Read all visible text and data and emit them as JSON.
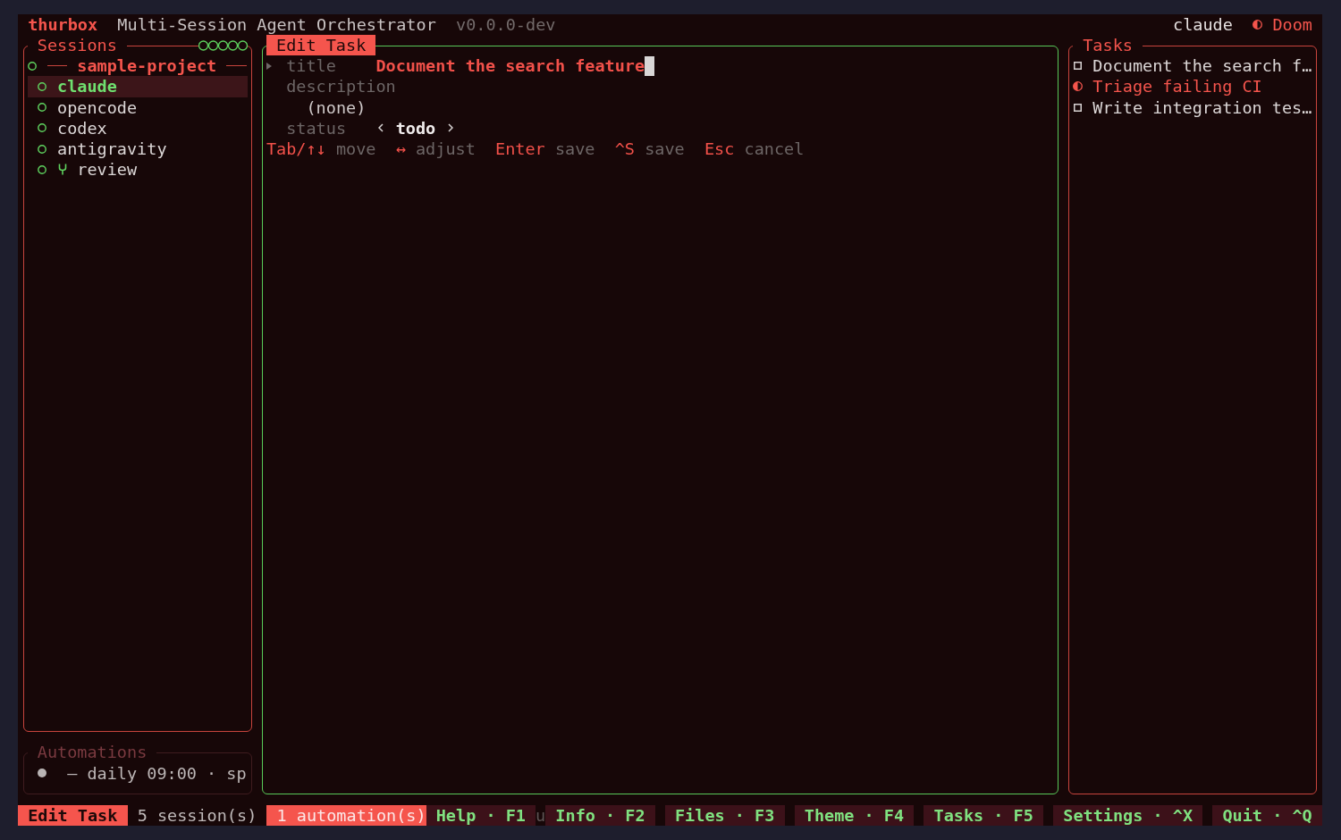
{
  "header": {
    "app_name": "thurbox",
    "title": "Multi-Session Agent Orchestrator",
    "version": "v0.0.0-dev",
    "session": "claude",
    "theme": "Doom"
  },
  "sessions_panel": {
    "title": "Sessions",
    "focused": false,
    "projects": [
      {
        "name": "sample-project",
        "sessions": [
          {
            "name": "claude",
            "selected": true,
            "worktree": false
          },
          {
            "name": "opencode",
            "selected": false,
            "worktree": false
          },
          {
            "name": "codex",
            "selected": false,
            "worktree": false
          },
          {
            "name": "antigravity",
            "selected": false,
            "worktree": false
          },
          {
            "name": "review",
            "selected": false,
            "worktree": true
          }
        ]
      }
    ]
  },
  "automations_panel": {
    "title": "Automations",
    "dimmed": true,
    "items": [
      {
        "text": "— daily 09:00 · sp"
      }
    ]
  },
  "edit_task": {
    "title": "Edit Task",
    "focused": true,
    "fields": [
      {
        "kind": "text",
        "label": "title",
        "value": "Document the search feature",
        "focused": true
      },
      {
        "kind": "multiline",
        "label": "description",
        "placeholder": "(none)",
        "focused": false
      },
      {
        "kind": "select",
        "label": "status",
        "value": "todo",
        "focused": false
      }
    ],
    "hints": [
      {
        "key": "Tab/↑↓",
        "action": "move"
      },
      {
        "key": "↔",
        "action": "adjust"
      },
      {
        "key": "Enter",
        "action": "save"
      },
      {
        "key": "^S",
        "action": "save"
      },
      {
        "key": "Esc",
        "action": "cancel"
      }
    ]
  },
  "tasks_panel": {
    "title": "Tasks",
    "focused": false,
    "items": [
      {
        "title": "Document the search f…",
        "kind": "todo"
      },
      {
        "title": "Triage failing CI",
        "kind": "active"
      },
      {
        "title": "Write integration tes…",
        "kind": "todo"
      }
    ]
  },
  "status_bar": {
    "items": [
      {
        "kind": "mode",
        "text": "Edit Task"
      },
      {
        "kind": "info",
        "text": "5 session(s)"
      },
      {
        "kind": "alert",
        "text": "1 automation(s)"
      },
      {
        "kind": "key",
        "text": "Help · F1"
      },
      {
        "kind": "glyph",
        "text": "u"
      },
      {
        "kind": "key",
        "text": "Info · F2"
      },
      {
        "kind": "key",
        "text": "Files · F3"
      },
      {
        "kind": "key",
        "text": "Theme · F4"
      },
      {
        "kind": "key",
        "text": "Tasks · F5"
      },
      {
        "kind": "key",
        "text": "Settings · ^X"
      },
      {
        "kind": "key",
        "text": "Quit · ^Q"
      }
    ]
  }
}
